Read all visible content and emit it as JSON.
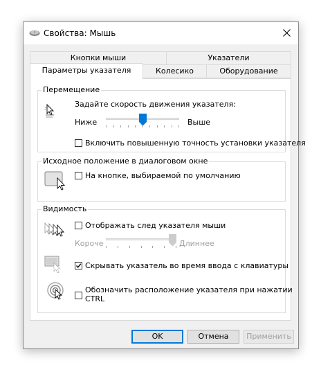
{
  "window": {
    "title": "Свойства: Мышь"
  },
  "tabs": {
    "row_back": [
      "Кнопки мыши",
      "Указатели"
    ],
    "row_front": [
      "Параметры указателя",
      "Колесико",
      "Оборудование"
    ],
    "active": "Параметры указателя"
  },
  "motion": {
    "title": "Перемещение",
    "speed_label": "Задайте скорость движения указателя:",
    "slow_label": "Ниже",
    "fast_label": "Выше",
    "speed_level": 0.5,
    "precision_label": "Включить повышенную точность установки указателя",
    "precision_checked": false
  },
  "snap": {
    "title": "Исходное положение в диалоговом окне",
    "snap_label": "На кнопке, выбираемой по умолчанию",
    "snap_checked": false
  },
  "visibility": {
    "title": "Видимость",
    "trails_label": "Отображать след указателя мыши",
    "trails_checked": false,
    "short_label": "Короче",
    "long_label": "Длиннее",
    "trail_level": 1.0,
    "hide_label": "Скрывать указатель во время ввода с клавиатуры",
    "hide_checked": true,
    "ctrl_label_line1": "Обозначить расположение указателя при нажатии",
    "ctrl_label_line2": "CTRL",
    "ctrl_checked": false
  },
  "buttons": {
    "ok": "OK",
    "cancel": "Отмена",
    "apply": "Применить"
  },
  "colors": {
    "accent": "#0078d7",
    "dialog_bg": "#f0f0f0",
    "panel_bg": "#ffffff",
    "disabled_text": "#a0a0a0"
  },
  "icons": [
    "mouse-icon",
    "close-icon",
    "pointer-speed-icon",
    "snap-to-icon",
    "pointer-trails-icon",
    "hide-pointer-icon",
    "locate-pointer-icon"
  ]
}
